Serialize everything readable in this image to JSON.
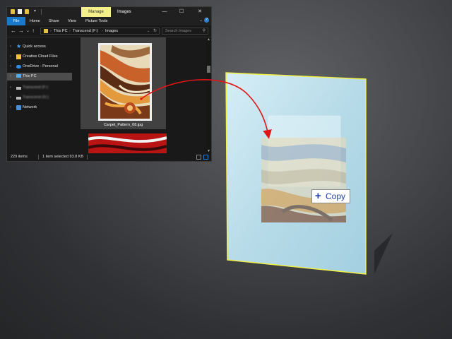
{
  "explorer": {
    "ribbon": {
      "manage_tab": "Manage",
      "window_title": "Images",
      "tabs": [
        "File",
        "Home",
        "Share",
        "View",
        "Picture Tools"
      ]
    },
    "window_controls": {
      "minimize": "—",
      "maximize": "☐",
      "close": "✕"
    },
    "nav": {
      "back": "←",
      "forward": "→",
      "recent": "⌄",
      "up": "↑",
      "breadcrumb": [
        "This PC",
        "Transcend (F:)",
        "Images"
      ],
      "search_placeholder": "Search Images"
    },
    "navpane": {
      "items": [
        {
          "label": "Quick access",
          "icon": "star-icon"
        },
        {
          "label": "Creative Cloud Files",
          "icon": "creative-cloud-icon"
        },
        {
          "label": "OneDrive - Personal",
          "icon": "onedrive-icon"
        },
        {
          "label": "This PC",
          "icon": "pc-icon",
          "selected": true
        },
        {
          "label": "Transcend (F:)",
          "icon": "drive-icon",
          "blurred": true
        },
        {
          "label": "Transcend (G:)",
          "icon": "drive-icon",
          "blurred": true
        },
        {
          "label": "Network",
          "icon": "network-icon"
        }
      ]
    },
    "content": {
      "selected_file": "Carpet_Pattern_08.jpg"
    },
    "status": {
      "item_count": "229 items",
      "selection": "1 item selected  93.8 KB"
    }
  },
  "drop_target": {
    "copy_label": "Copy",
    "copy_symbol": "+"
  },
  "colors": {
    "accent_blue": "#1979ca",
    "manage_yellow": "#f5f08a",
    "drag_arrow_red": "#e01515",
    "panel_border_yellow": "#f2f246",
    "panel_fill": "#b9dde9"
  }
}
